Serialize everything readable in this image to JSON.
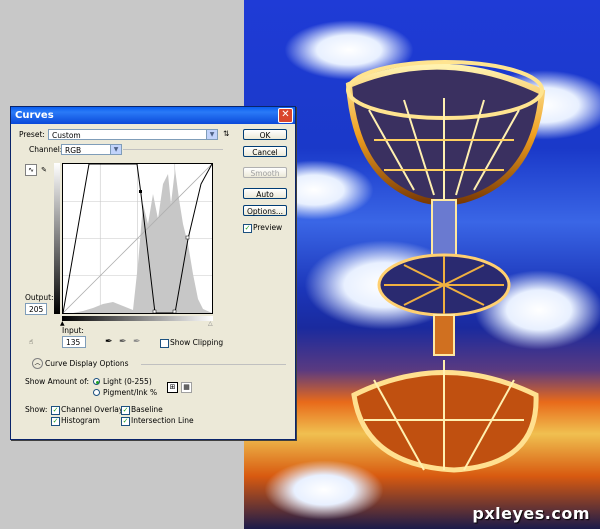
{
  "dialog": {
    "title": "Curves",
    "close_glyph": "✕",
    "preset_label": "Preset:",
    "preset_value": "Custom",
    "channel_label": "Channel:",
    "channel_value": "RGB",
    "output_label": "Output:",
    "output_value": "205",
    "input_label": "Input:",
    "input_value": "135",
    "show_clipping_label": "Show Clipping",
    "curve_display_options_label": "Curve Display Options",
    "show_amount_label": "Show Amount of:",
    "light_label": "Light  (0-255)",
    "pigment_label": "Pigment/Ink %",
    "show_label": "Show:",
    "channel_overlays_label": "Channel Overlays",
    "baseline_label": "Baseline",
    "histogram_label": "Histogram",
    "intersection_line_label": "Intersection Line",
    "buttons": {
      "ok": "OK",
      "cancel": "Cancel",
      "smooth": "Smooth",
      "auto": "Auto",
      "options": "Options..."
    },
    "preview_label": "Preview"
  },
  "watermark": "pxleyes.com",
  "icons": {
    "preset_menu": "preset-options-icon",
    "curve_tool": "curve-point-icon",
    "pencil_tool": "pencil-icon",
    "on_image_tool": "hand-adjust-icon",
    "eyedroppers": [
      "black-eyedropper-icon",
      "gray-eyedropper-icon",
      "white-eyedropper-icon"
    ],
    "grid_simple": "grid-4x4-icon",
    "grid_detailed": "grid-10x10-icon",
    "expand": "chevron-up-icon"
  },
  "colors": {
    "title_bar": "#0a5ef0",
    "dialog_bg": "#ece9d8",
    "sky": "#1f3bd6",
    "glow": "#f0c050"
  }
}
